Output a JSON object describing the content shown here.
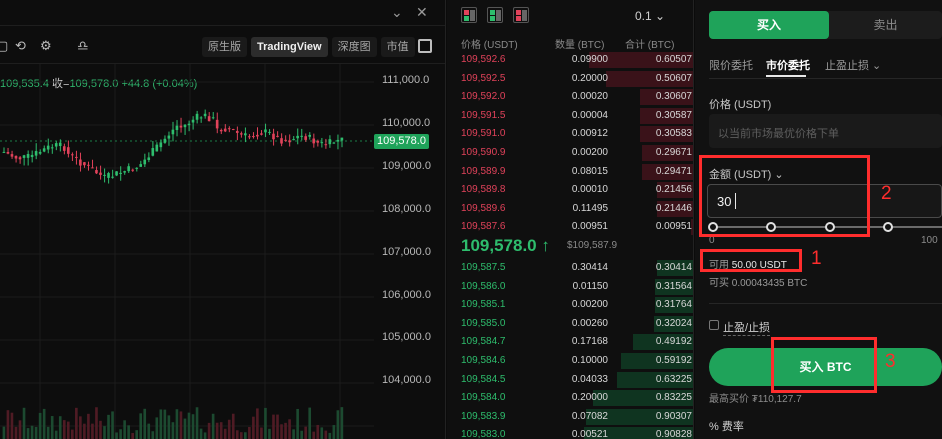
{
  "chart": {
    "window_controls": [
      "⌄",
      "✕"
    ],
    "view_tabs": [
      "原生版",
      "TradingView",
      "深度图",
      "市值"
    ],
    "active_view": "TradingView",
    "ohlc": {
      "close_value": "109,535.4",
      "close_label": "收=",
      "close_price": "109,578.0",
      "change": "+44.8 (+0.04%)"
    },
    "price_ticks": [
      "111,000.0",
      "110,000.0",
      "109,000.0",
      "108,000.0",
      "107,000.0",
      "106,000.0",
      "105,000.0",
      "104,000.0"
    ],
    "last_price_tag": "109,578.0",
    "colors": {
      "up": "#2ebd6d",
      "down": "#e0425a",
      "accent": "#1fa35a"
    }
  },
  "orderbook": {
    "tick_size": "0.1 ⌄",
    "columns": {
      "price": "价格 (USDT)",
      "qty": "数量 (BTC)",
      "total": "合计 (BTC)"
    },
    "asks": [
      {
        "price": "109,592.6",
        "qty": "0.09900",
        "total": "0.60507",
        "depth": 0.95
      },
      {
        "price": "109,592.5",
        "qty": "0.20000",
        "total": "0.50607",
        "depth": 0.8
      },
      {
        "price": "109,592.0",
        "qty": "0.00020",
        "total": "0.30607",
        "depth": 0.49
      },
      {
        "price": "109,591.5",
        "qty": "0.00004",
        "total": "0.30587",
        "depth": 0.49
      },
      {
        "price": "109,591.0",
        "qty": "0.00912",
        "total": "0.30583",
        "depth": 0.49
      },
      {
        "price": "109,590.9",
        "qty": "0.00200",
        "total": "0.29671",
        "depth": 0.47
      },
      {
        "price": "109,589.9",
        "qty": "0.08015",
        "total": "0.29471",
        "depth": 0.47
      },
      {
        "price": "109,589.8",
        "qty": "0.00010",
        "total": "0.21456",
        "depth": 0.34
      },
      {
        "price": "109,589.6",
        "qty": "0.11495",
        "total": "0.21446",
        "depth": 0.34
      },
      {
        "price": "109,587.6",
        "qty": "0.00951",
        "total": "0.00951",
        "depth": 0.03
      }
    ],
    "mid_price": "109,578.0 ↑",
    "mark_price": "$109,587.9",
    "bids": [
      {
        "price": "109,587.5",
        "qty": "0.30414",
        "total": "0.30414",
        "depth": 0.34
      },
      {
        "price": "109,586.0",
        "qty": "0.01150",
        "total": "0.31564",
        "depth": 0.35
      },
      {
        "price": "109,585.1",
        "qty": "0.00200",
        "total": "0.31764",
        "depth": 0.35
      },
      {
        "price": "109,585.0",
        "qty": "0.00260",
        "total": "0.32024",
        "depth": 0.36
      },
      {
        "price": "109,584.7",
        "qty": "0.17168",
        "total": "0.49192",
        "depth": 0.55
      },
      {
        "price": "109,584.6",
        "qty": "0.10000",
        "total": "0.59192",
        "depth": 0.66
      },
      {
        "price": "109,584.5",
        "qty": "0.04033",
        "total": "0.63225",
        "depth": 0.7
      },
      {
        "price": "109,584.0",
        "qty": "0.20000",
        "total": "0.83225",
        "depth": 0.92
      },
      {
        "price": "109,583.9",
        "qty": "0.07082",
        "total": "0.90307",
        "depth": 0.98
      },
      {
        "price": "109,583.0",
        "qty": "0.00521",
        "total": "0.90828",
        "depth": 1.0
      }
    ]
  },
  "trade": {
    "buy_tab": "买入",
    "sell_tab": "卖出",
    "order_types": [
      "限价委托",
      "市价委托",
      "止盈止损 ⌄"
    ],
    "active_order_type": "市价委托",
    "price_label": "价格 (USDT)",
    "price_placeholder": "以当前市场最优价格下单",
    "amount_label": "金额 (USDT) ⌄",
    "amount_value": "30",
    "slider_min": "0",
    "slider_max": "100",
    "available_label": "可用",
    "available_value": "50.00 USDT",
    "buyable_label": "可买",
    "buyable_value": "0.00043435 BTC",
    "tpsl_label": "止盈/止损",
    "buy_button": "买入 BTC",
    "max_price_label": "最高买价",
    "max_price_value": "₮110,127.7",
    "fee_label": "费率"
  },
  "annotations": [
    "1",
    "2",
    "3"
  ]
}
